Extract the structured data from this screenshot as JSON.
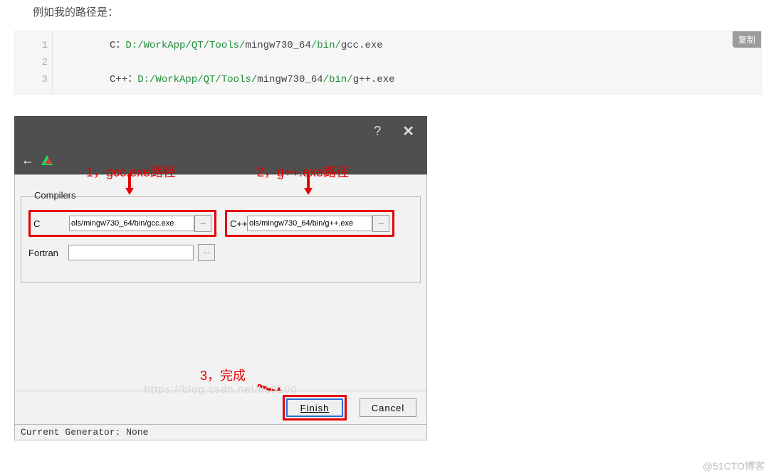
{
  "intro_text": "例如我的路径是：",
  "code": {
    "line1_label": "C：",
    "line1_green": "D:/WorkApp/QT/Tools/",
    "line1_plain": "mingw730_64",
    "line1_green2": "/bin/",
    "line1_tail": "gcc.exe",
    "line3_label": "C++：",
    "line3_green": "D:/WorkApp/QT/Tools/",
    "line3_plain": "mingw730_64",
    "line3_green2": "/bin/",
    "line3_tail": "g++.exe",
    "copy_label": "复制",
    "ln1": "1",
    "ln2": "2",
    "ln3": "3"
  },
  "dialog": {
    "help": "?",
    "close": "✕",
    "back": "←",
    "compilers_legend": "Compilers",
    "c_label": "C",
    "c_value": "ols/mingw730_64/bin/gcc.exe",
    "cpp_label": "C++",
    "cpp_value": "ols/mingw730_64/bin/g++.exe",
    "fortran_label": "Fortran",
    "fortran_value": "",
    "browse_label": "...",
    "finish_label": "Finish",
    "cancel_label": "Cancel",
    "status": "Current Generator: None"
  },
  "annotations": {
    "a1": "1，gcc.exe路径",
    "a2": "2，g++.exe路径",
    "a3": "3，完成"
  },
  "footer_text": "@51CTO博客",
  "watermark": "https://blog.csdn.net/llc0100"
}
